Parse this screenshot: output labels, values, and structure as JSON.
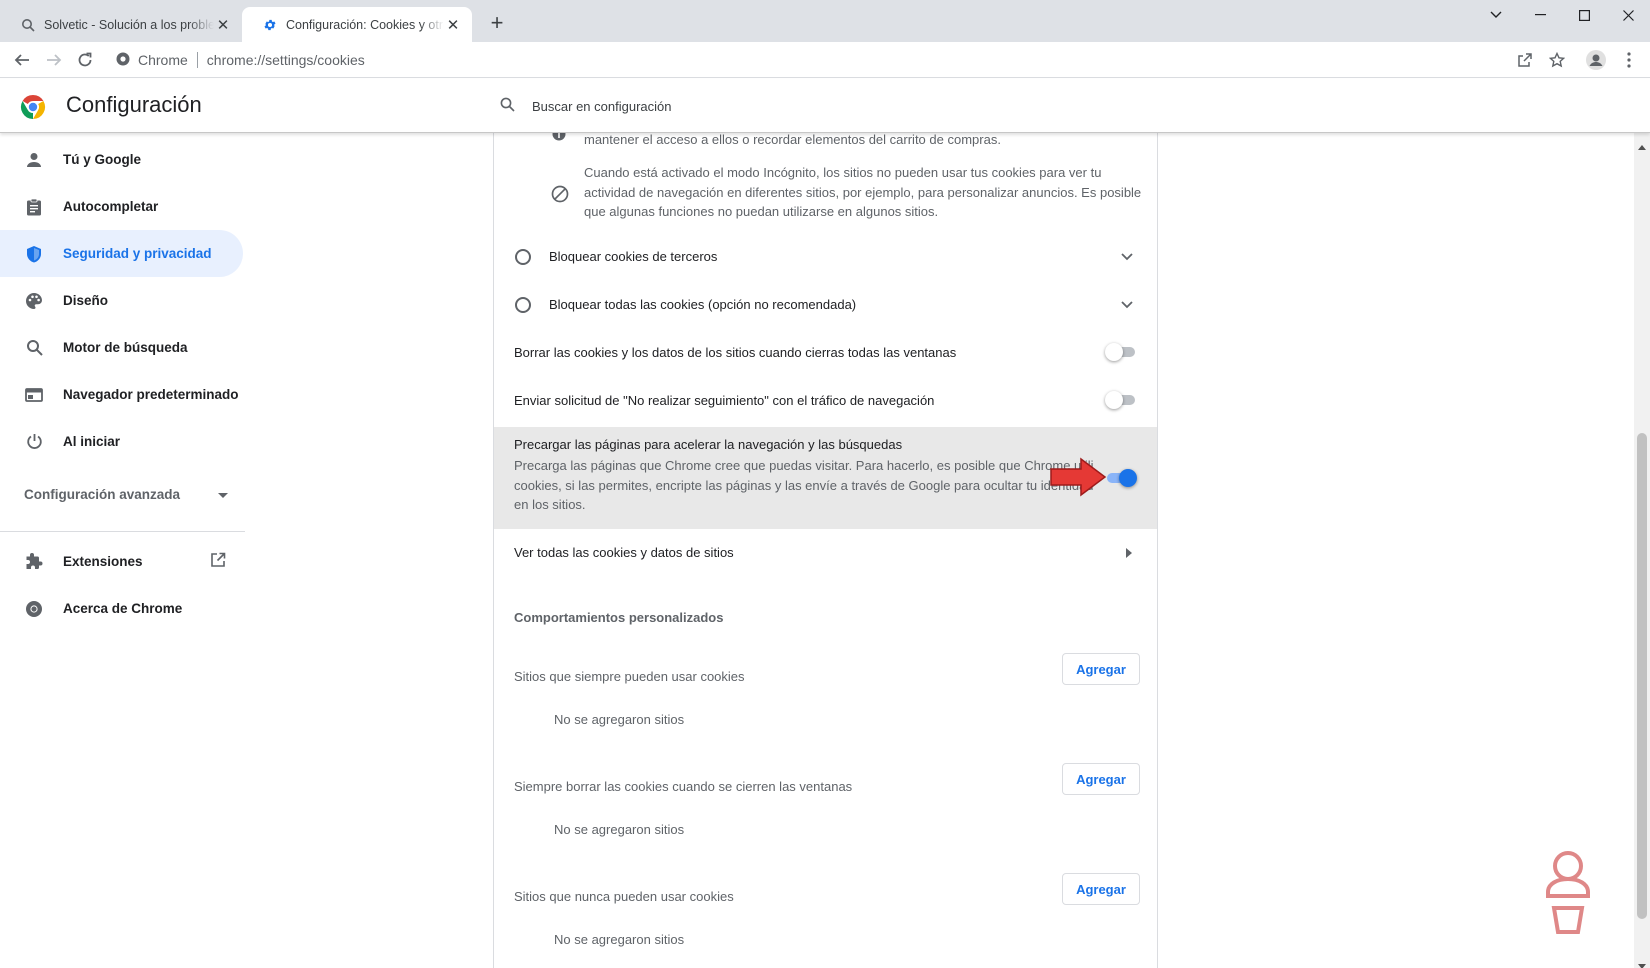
{
  "browser": {
    "tabs": [
      {
        "title": "Solvetic - Solución a los problemas informáticos",
        "icon": "search-favicon",
        "active": false
      },
      {
        "title": "Configuración: Cookies y otros datos de sitios",
        "icon": "gear-favicon",
        "active": true
      }
    ],
    "new_tab": "+",
    "window_controls": {
      "minimize": "—",
      "maximize": "☐",
      "close": "✕",
      "tab_search": "⌄"
    },
    "omnibox": {
      "site": "Chrome",
      "url": "chrome://settings/cookies"
    }
  },
  "header": {
    "title": "Configuración",
    "search_placeholder": "Buscar en configuración"
  },
  "sidebar": {
    "items": [
      {
        "label": "Tú y Google",
        "icon": "person-icon"
      },
      {
        "label": "Autocompletar",
        "icon": "clipboard-icon"
      },
      {
        "label": "Seguridad y privacidad",
        "icon": "shield-icon",
        "active": true
      },
      {
        "label": "Diseño",
        "icon": "palette-icon"
      },
      {
        "label": "Motor de búsqueda",
        "icon": "search-icon"
      },
      {
        "label": "Navegador predeterminado",
        "icon": "browser-icon"
      },
      {
        "label": "Al iniciar",
        "icon": "power-icon"
      }
    ],
    "advanced": "Configuración avanzada",
    "extensions": "Extensiones",
    "about": "Acerca de Chrome"
  },
  "main": {
    "top_partial_text": "mantener el acceso a ellos o recordar elementos del carrito de compras.",
    "incognito_text": "Cuando está activado el modo Incógnito, los sitios no pueden usar tus cookies para ver tu actividad de navegación en diferentes sitios, por ejemplo, para personalizar anuncios. Es posible que algunas funciones no puedan utilizarse en algunos sitios.",
    "incognito_lines": [
      "Cuando está activado el modo Incógnito, los sitios no pueden usar tus cookies para ver tu",
      "actividad de navegación en diferentes sitios, por ejemplo, para personalizar anuncios. Es posible",
      "que algunas funciones no puedan utilizarse en algunos sitios."
    ],
    "block_third_party": "Bloquear cookies de terceros",
    "block_all": "Bloquear todas las cookies (opción no recomendada)",
    "clear_on_close": {
      "label": "Borrar las cookies y los datos de los sitios cuando cierras todas las ventanas",
      "enabled": false
    },
    "do_not_track": {
      "label": "Enviar solicitud de \"No realizar seguimiento\" con el tráfico de navegación",
      "enabled": false
    },
    "preload": {
      "label": "Precargar las páginas para acelerar la navegación y las búsquedas",
      "description_lines": [
        "Precarga las páginas que Chrome cree que puedas visitar. Para hacerlo, es posible que Chrome utilice",
        "cookies, si las permites, encripte las páginas y las envíe a través de Google para ocultar tu identidad",
        "en los sitios."
      ],
      "enabled": true
    },
    "see_all": "Ver todas las cookies y datos de sitios",
    "custom_behaviors": "Comportamientos personalizados",
    "sections": [
      {
        "label": "Sitios que siempre pueden usar cookies",
        "button": "Agregar",
        "empty": "No se agregaron sitios"
      },
      {
        "label": "Siempre borrar las cookies cuando se cierren las ventanas",
        "button": "Agregar",
        "empty": "No se agregaron sitios"
      },
      {
        "label": "Sitios que nunca pueden usar cookies",
        "button": "Agregar",
        "empty": "No se agregaron sitios"
      }
    ]
  },
  "colors": {
    "accent": "#1a73e8",
    "annotation_arrow": "#e53935",
    "active_bg": "#e8f0fe"
  }
}
